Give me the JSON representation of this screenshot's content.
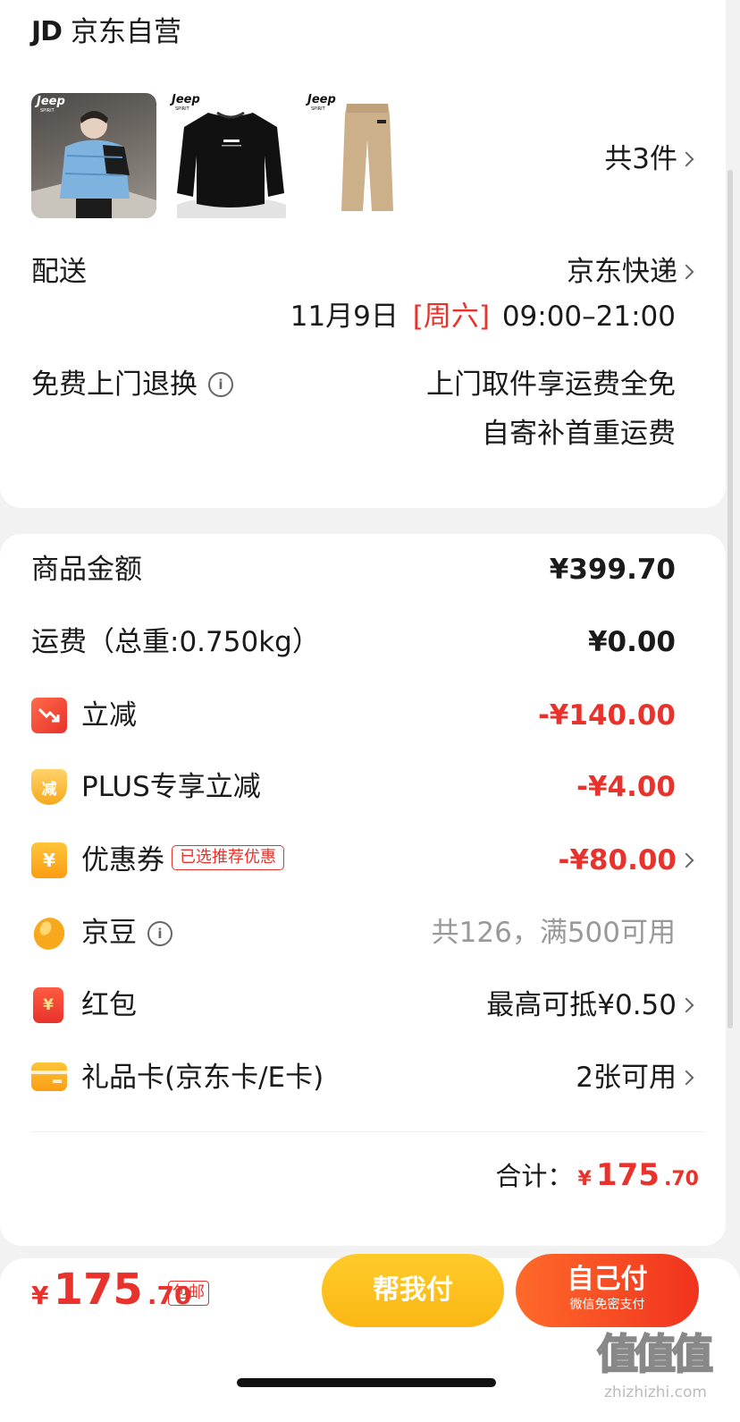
{
  "store": {
    "logo": "JD",
    "name": "京东自营"
  },
  "products": {
    "thumbnails": [
      {
        "brand": "Jeep",
        "sub": "SPIRIT",
        "kind": "blue-puffer-jacket"
      },
      {
        "brand": "Jeep",
        "sub": "SPIRIT",
        "kind": "black-sweatshirt"
      },
      {
        "brand": "Jeep",
        "sub": "SPIRIT",
        "kind": "khaki-pants"
      }
    ],
    "count_label": "共3件"
  },
  "delivery": {
    "label": "配送",
    "carrier": "京东快递",
    "date": "11月9日",
    "weekday": "[周六]",
    "time": "09:00–21:00"
  },
  "return": {
    "label": "免费上门退换",
    "line1": "上门取件享运费全免",
    "line2": "自寄补首重运费"
  },
  "summary": {
    "goods_label": "商品金额",
    "goods_value": "¥399.70",
    "shipping_label": "运费（总重:0.750kg）",
    "shipping_value": "¥0.00",
    "instant_label": "立减",
    "instant_value": "-¥140.00",
    "plus_label": "PLUS专享立减",
    "plus_value": "-¥4.00",
    "plus_icon_text": "减",
    "coupon_label": "优惠券",
    "coupon_tag": "已选推荐优惠",
    "coupon_value": "-¥80.00",
    "coupon_icon_text": "¥",
    "jingdou_label": "京豆",
    "jingdou_value": "共126，满500可用",
    "redpacket_label": "红包",
    "redpacket_value": "最高可抵¥0.50",
    "redpacket_icon_text": "¥",
    "giftcard_label": "礼品卡(京东卡/E卡)",
    "giftcard_value": "2张可用",
    "total_label": "合计：",
    "total_currency": "¥",
    "total_int": "175",
    "total_dec": ".70"
  },
  "footer": {
    "currency": "¥",
    "price_int": "175",
    "price_dec": ".70",
    "badge": "包邮",
    "help_pay": "帮我付",
    "self_pay": "自己付",
    "self_pay_sub": "微信免密支付"
  },
  "watermark": {
    "glyphs": "值值值",
    "url": "zhizhizhi.com"
  },
  "colors": {
    "accent_red": "#e8322b",
    "help_pay_yellow": "#fbb714",
    "self_pay_red": "#f04a22"
  }
}
